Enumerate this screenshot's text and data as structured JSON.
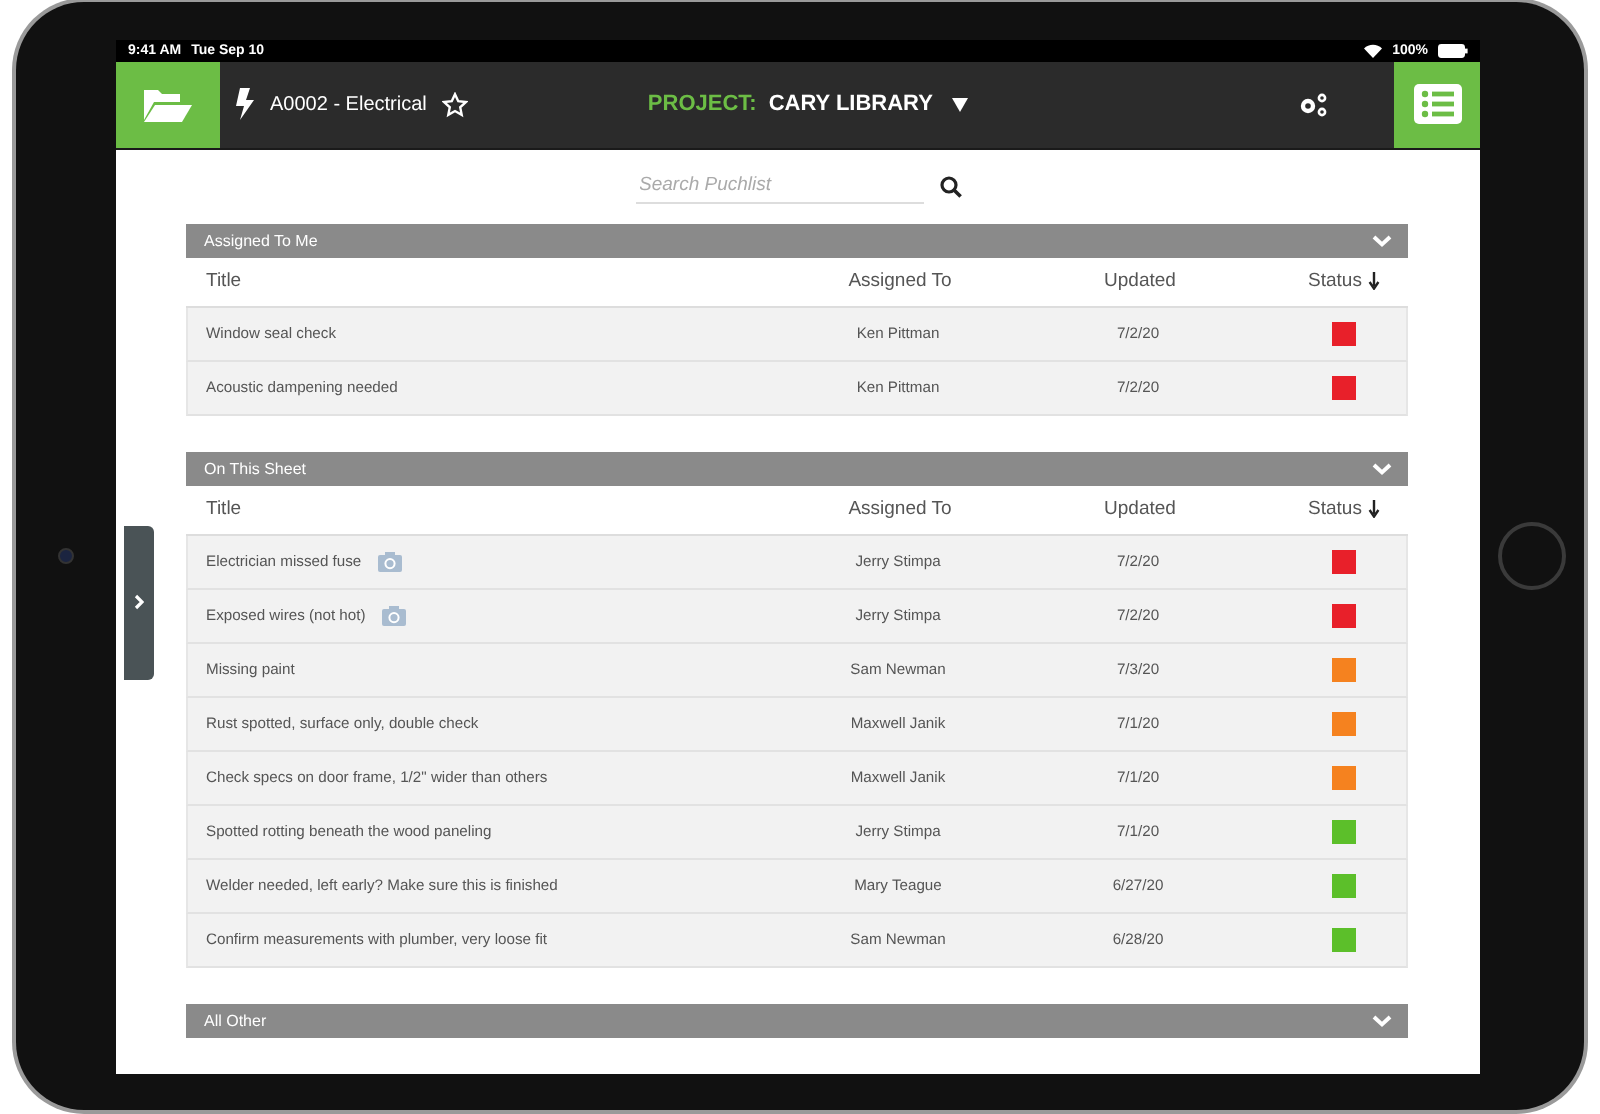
{
  "status_bar": {
    "time": "9:41 AM",
    "date": "Tue Sep 10",
    "battery": "100%"
  },
  "toolbar": {
    "sheet": "A0002 - Electrical",
    "project_label": "PROJECT:",
    "project_name": "CARY LIBRARY"
  },
  "search": {
    "placeholder": "Search Puchlist"
  },
  "sections": [
    {
      "title": "Assigned To Me",
      "columns": [
        "Title",
        "Assigned To",
        "Updated",
        "Status"
      ],
      "rows": [
        {
          "title": "Window seal check",
          "assigned_to": "Ken Pittman",
          "updated": "7/2/20",
          "color": "#e8202a",
          "has_photo": false
        },
        {
          "title": "Acoustic dampening needed",
          "assigned_to": "Ken Pittman",
          "updated": "7/2/20",
          "color": "#e8202a",
          "has_photo": false
        }
      ]
    },
    {
      "title": "On This Sheet",
      "columns": [
        "Title",
        "Assigned To",
        "Updated",
        "Status"
      ],
      "rows": [
        {
          "title": "Electrician missed fuse",
          "assigned_to": "Jerry Stimpa",
          "updated": "7/2/20",
          "color": "#e8202a",
          "has_photo": true
        },
        {
          "title": "Exposed wires (not hot)",
          "assigned_to": "Jerry Stimpa",
          "updated": "7/2/20",
          "color": "#e8202a",
          "has_photo": true
        },
        {
          "title": "Missing paint",
          "assigned_to": "Sam Newman",
          "updated": "7/3/20",
          "color": "#f5821f",
          "has_photo": false
        },
        {
          "title": "Rust spotted, surface only, double check",
          "assigned_to": "Maxwell Janik",
          "updated": "7/1/20",
          "color": "#f5821f",
          "has_photo": false
        },
        {
          "title": "Check specs on door frame, 1/2\" wider than others",
          "assigned_to": "Maxwell Janik",
          "updated": "7/1/20",
          "color": "#f5821f",
          "has_photo": false
        },
        {
          "title": "Spotted rotting beneath the wood paneling",
          "assigned_to": "Jerry Stimpa",
          "updated": "7/1/20",
          "color": "#5cbf2a",
          "has_photo": false
        },
        {
          "title": "Welder needed, left early? Make sure this is finished",
          "assigned_to": "Mary Teague",
          "updated": "6/27/20",
          "color": "#5cbf2a",
          "has_photo": false
        },
        {
          "title": "Confirm measurements with plumber, very loose fit",
          "assigned_to": "Sam Newman",
          "updated": "6/28/20",
          "color": "#5cbf2a",
          "has_photo": false
        }
      ]
    },
    {
      "title": "All Other"
    }
  ]
}
